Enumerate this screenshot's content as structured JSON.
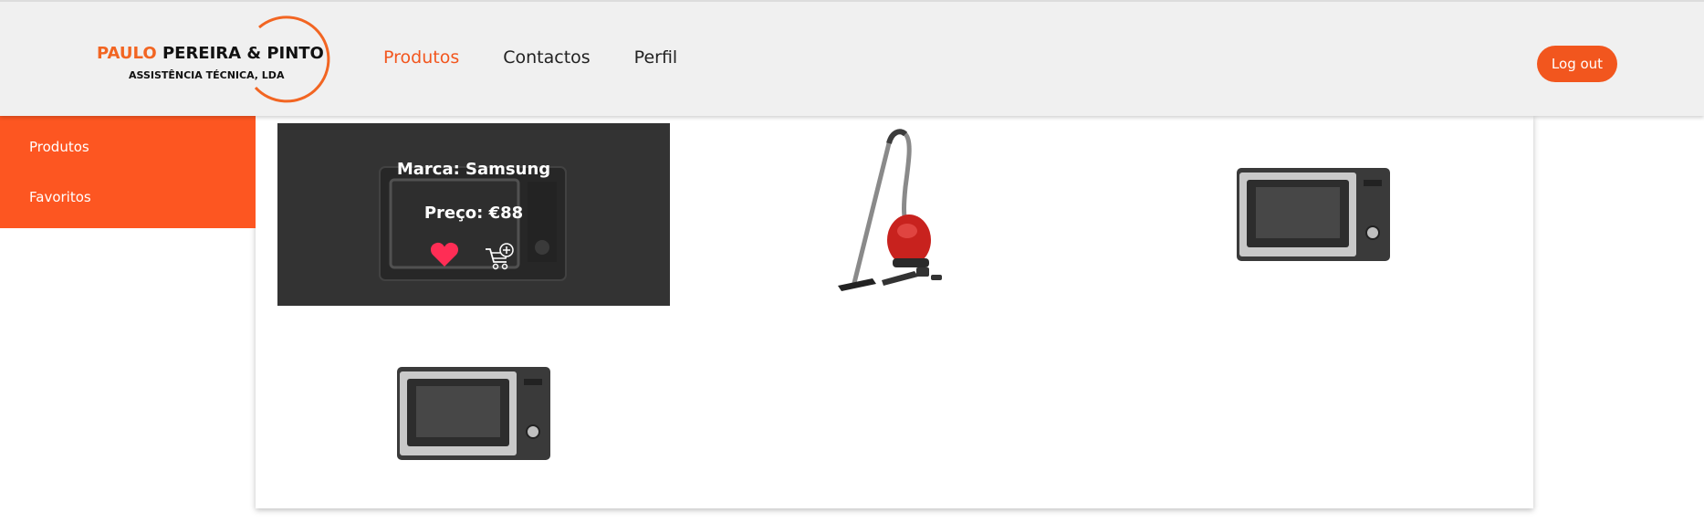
{
  "brand": {
    "name_accent": "PAULO",
    "name_rest": "PEREIRA & PINTO",
    "subtitle": "ASSISTÊNCIA TÉCNICA, LDA",
    "accent_color": "#f26522"
  },
  "nav": {
    "items": [
      {
        "label": "Produtos",
        "active": true
      },
      {
        "label": "Contactos",
        "active": false
      },
      {
        "label": "Perfil",
        "active": false
      }
    ],
    "logout_label": "Log out"
  },
  "sidebar": {
    "items": [
      {
        "label": "Produtos"
      },
      {
        "label": "Favoritos"
      }
    ],
    "color": "#fd5621"
  },
  "products": [
    {
      "kind": "microwave",
      "icon": "microwave-image",
      "hovered": true,
      "brand_text": "Marca: Samsung",
      "price_text": "Preço: €88",
      "favorite": true
    },
    {
      "kind": "vacuum",
      "icon": "vacuum-cleaner-image",
      "hovered": false
    },
    {
      "kind": "microwave",
      "icon": "microwave-image",
      "hovered": false
    },
    {
      "kind": "microwave",
      "icon": "microwave-image",
      "hovered": false
    }
  ]
}
